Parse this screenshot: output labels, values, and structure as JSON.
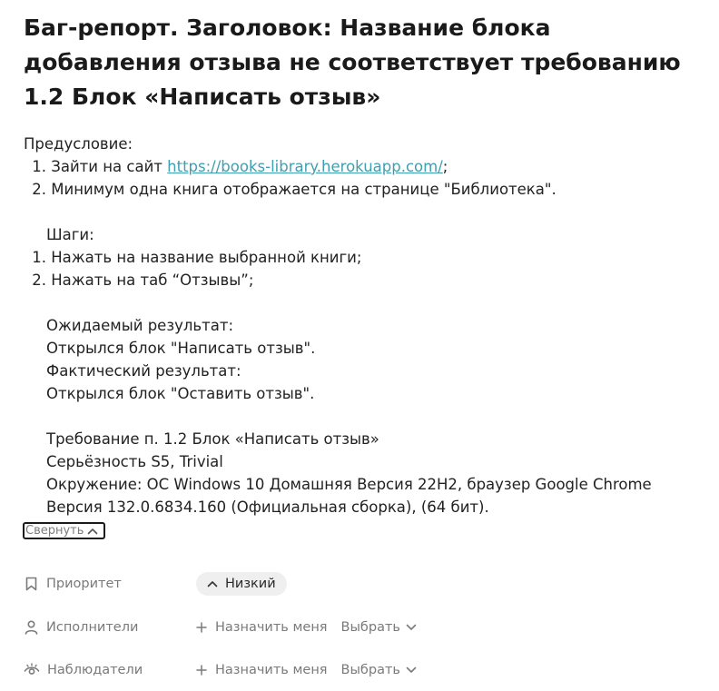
{
  "title": "Баг-репорт. Заголовок: Название блока добавления отзыва не соответствует требованию 1.2 Блок «Написать отзыв»",
  "precondition": {
    "heading": "Предусловие:",
    "items": [
      {
        "num": "1.",
        "before": "Зайти на сайт ",
        "link": "https://books-library.herokuapp.com/",
        "after": ";"
      },
      {
        "num": "2.",
        "text": "Минимум одна книга отображается на странице \"Библиотека\"."
      }
    ]
  },
  "steps": {
    "heading": "Шаги:",
    "items": [
      {
        "num": "1.",
        "text": "Нажать на название выбранной книги;"
      },
      {
        "num": "2.",
        "text": "Нажать на таб “Отзывы”;"
      }
    ]
  },
  "expected": {
    "heading": "Ожидаемый результат:",
    "text": "Открылся блок \"Написать отзыв\"."
  },
  "actual": {
    "heading": "Фактический результат:",
    "text": "Открылся блок \"Оставить отзыв\"."
  },
  "details": {
    "requirement": "Требование п. 1.2 Блок «Написать отзыв»",
    "severity": "Серьёзность S5, Trivial",
    "env_line1": "Окружение: ОС Windows 10 Домашняя Версия 22H2, браузер Google Chrome",
    "env_line2": "Версия 132.0.6834.160 (Официальная сборка), (64 бит)."
  },
  "collapse_label": "Свернуть",
  "properties": {
    "priority": {
      "label": "Приоритет",
      "value": "Низкий"
    },
    "assignees": {
      "label": "Исполнители",
      "assign_me": "Назначить меня",
      "choose": "Выбрать"
    },
    "watchers": {
      "label": "Наблюдатели",
      "assign_me": "Назначить меня",
      "choose": "Выбрать"
    }
  },
  "colors": {
    "link": "#3f9fb0",
    "muted": "#7a7a7a",
    "pill_bg": "#efefef"
  }
}
